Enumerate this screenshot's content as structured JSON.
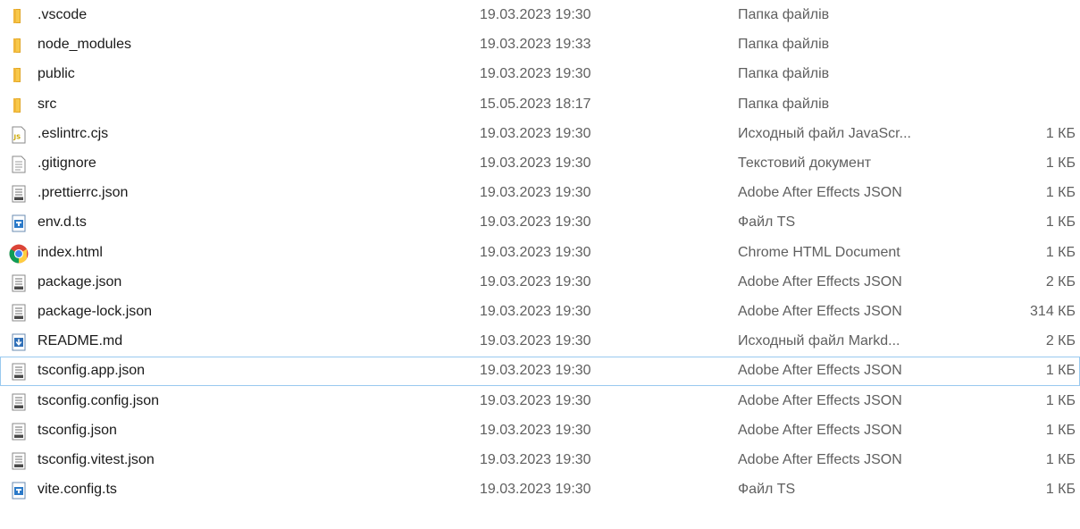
{
  "files": [
    {
      "name": ".vscode",
      "date": "19.03.2023 19:30",
      "type": "Папка файлів",
      "size": "",
      "icon": "folder-icon"
    },
    {
      "name": "node_modules",
      "date": "19.03.2023 19:33",
      "type": "Папка файлів",
      "size": "",
      "icon": "folder-icon"
    },
    {
      "name": "public",
      "date": "19.03.2023 19:30",
      "type": "Папка файлів",
      "size": "",
      "icon": "folder-icon"
    },
    {
      "name": "src",
      "date": "15.05.2023 18:17",
      "type": "Папка файлів",
      "size": "",
      "icon": "folder-icon"
    },
    {
      "name": ".eslintrc.cjs",
      "date": "19.03.2023 19:30",
      "type": "Исходный файл JavaScr...",
      "size": "1 КБ",
      "icon": "js-file-icon"
    },
    {
      "name": ".gitignore",
      "date": "19.03.2023 19:30",
      "type": "Текстовий документ",
      "size": "1 КБ",
      "icon": "text-file-icon"
    },
    {
      "name": ".prettierrc.json",
      "date": "19.03.2023 19:30",
      "type": "Adobe After Effects JSON",
      "size": "1 КБ",
      "icon": "json-file-icon"
    },
    {
      "name": "env.d.ts",
      "date": "19.03.2023 19:30",
      "type": "Файл TS",
      "size": "1 КБ",
      "icon": "ts-file-icon"
    },
    {
      "name": "index.html",
      "date": "19.03.2023 19:30",
      "type": "Chrome HTML Document",
      "size": "1 КБ",
      "icon": "chrome-icon"
    },
    {
      "name": "package.json",
      "date": "19.03.2023 19:30",
      "type": "Adobe After Effects JSON",
      "size": "2 КБ",
      "icon": "json-file-icon"
    },
    {
      "name": "package-lock.json",
      "date": "19.03.2023 19:30",
      "type": "Adobe After Effects JSON",
      "size": "314 КБ",
      "icon": "json-file-icon"
    },
    {
      "name": "README.md",
      "date": "19.03.2023 19:30",
      "type": "Исходный файл Markd...",
      "size": "2 КБ",
      "icon": "markdown-file-icon"
    },
    {
      "name": "tsconfig.app.json",
      "date": "19.03.2023 19:30",
      "type": "Adobe After Effects JSON",
      "size": "1 КБ",
      "icon": "json-file-icon",
      "hovered": true
    },
    {
      "name": "tsconfig.config.json",
      "date": "19.03.2023 19:30",
      "type": "Adobe After Effects JSON",
      "size": "1 КБ",
      "icon": "json-file-icon"
    },
    {
      "name": "tsconfig.json",
      "date": "19.03.2023 19:30",
      "type": "Adobe After Effects JSON",
      "size": "1 КБ",
      "icon": "json-file-icon"
    },
    {
      "name": "tsconfig.vitest.json",
      "date": "19.03.2023 19:30",
      "type": "Adobe After Effects JSON",
      "size": "1 КБ",
      "icon": "json-file-icon"
    },
    {
      "name": "vite.config.ts",
      "date": "19.03.2023 19:30",
      "type": "Файл TS",
      "size": "1 КБ",
      "icon": "ts-file-icon"
    }
  ],
  "colors": {
    "folder": "#f8c84a",
    "hover_border": "#99c9ef",
    "ts_blue": "#2b7ac9",
    "js_yellow": "#e5c100"
  }
}
